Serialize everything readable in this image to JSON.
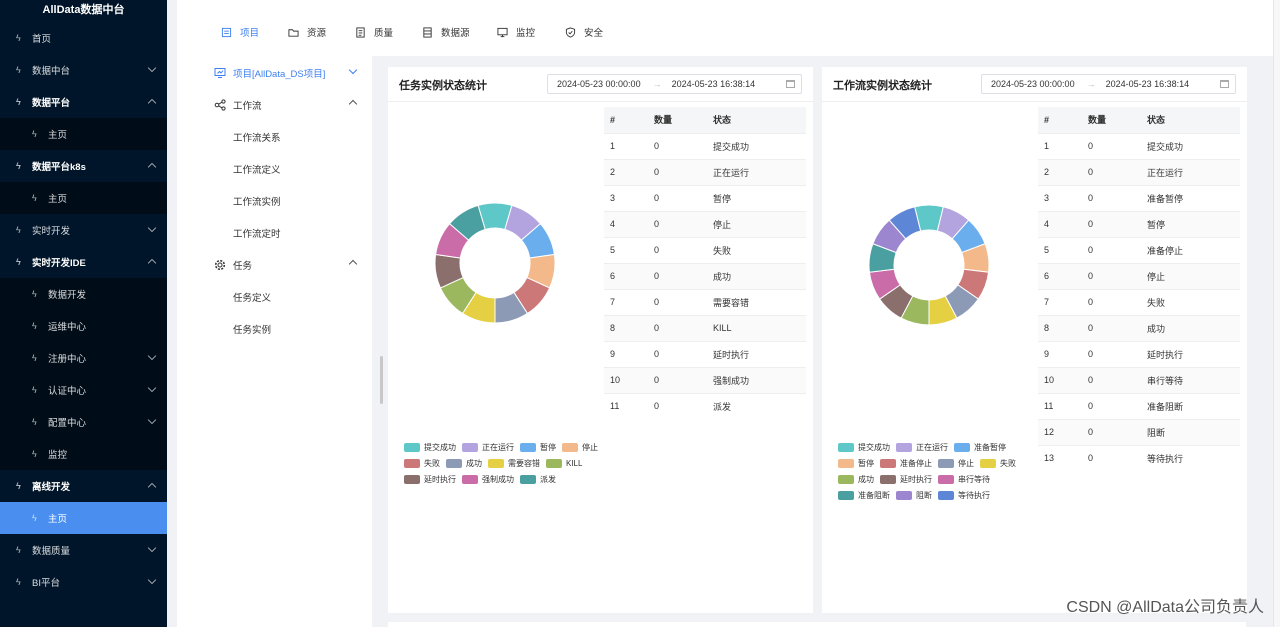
{
  "brand": "AllData数据中台",
  "sidebar": [
    {
      "label": "首页",
      "kind": "top",
      "chev": "none"
    },
    {
      "label": "数据中台",
      "kind": "top",
      "chev": "down"
    },
    {
      "label": "数据平台",
      "kind": "open",
      "chev": "up"
    },
    {
      "label": "主页",
      "kind": "sub",
      "chev": "none"
    },
    {
      "label": "数据平台k8s",
      "kind": "open",
      "chev": "up"
    },
    {
      "label": "主页",
      "kind": "sub",
      "chev": "none"
    },
    {
      "label": "实时开发",
      "kind": "top",
      "chev": "down"
    },
    {
      "label": "实时开发IDE",
      "kind": "open",
      "chev": "up"
    },
    {
      "label": "数据开发",
      "kind": "sub",
      "chev": "none"
    },
    {
      "label": "运维中心",
      "kind": "sub",
      "chev": "none"
    },
    {
      "label": "注册中心",
      "kind": "sub",
      "chev": "down"
    },
    {
      "label": "认证中心",
      "kind": "sub",
      "chev": "down"
    },
    {
      "label": "配置中心",
      "kind": "sub",
      "chev": "down"
    },
    {
      "label": "监控",
      "kind": "sub",
      "chev": "none"
    },
    {
      "label": "离线开发",
      "kind": "open",
      "chev": "up"
    },
    {
      "label": "主页",
      "kind": "active",
      "chev": "none"
    },
    {
      "label": "数据质量",
      "kind": "top",
      "chev": "down"
    },
    {
      "label": "BI平台",
      "kind": "top",
      "chev": "down"
    }
  ],
  "topnav": [
    {
      "label": "项目",
      "icon": "project-icon",
      "active": true
    },
    {
      "label": "资源",
      "icon": "folder-icon",
      "active": false
    },
    {
      "label": "质量",
      "icon": "quality-icon",
      "active": false
    },
    {
      "label": "数据源",
      "icon": "datasource-icon",
      "active": false
    },
    {
      "label": "监控",
      "icon": "monitor-icon",
      "active": false
    },
    {
      "label": "安全",
      "icon": "shield-icon",
      "active": false
    }
  ],
  "submenu": {
    "project": "项目[AllData_DS项目]",
    "workflow": "工作流",
    "workflow_items": [
      "工作流关系",
      "工作流定义",
      "工作流实例",
      "工作流定时"
    ],
    "task": "任务",
    "task_items": [
      "任务定义",
      "任务实例"
    ]
  },
  "task_card": {
    "title": "任务实例状态统计",
    "start": "2024-05-23 00:00:00",
    "end": "2024-05-23 16:38:14",
    "headers": [
      "#",
      "数量",
      "状态"
    ],
    "rows": [
      [
        "1",
        "0",
        "提交成功"
      ],
      [
        "2",
        "0",
        "正在运行"
      ],
      [
        "3",
        "0",
        "暂停"
      ],
      [
        "4",
        "0",
        "停止"
      ],
      [
        "5",
        "0",
        "失败"
      ],
      [
        "6",
        "0",
        "成功"
      ],
      [
        "7",
        "0",
        "需要容错"
      ],
      [
        "8",
        "0",
        "KILL"
      ],
      [
        "9",
        "0",
        "延时执行"
      ],
      [
        "10",
        "0",
        "强制成功"
      ],
      [
        "11",
        "0",
        "派发"
      ]
    ],
    "colors": [
      "#5ec8c8",
      "#b3a3de",
      "#6aaeee",
      "#f4b98a",
      "#cc7878",
      "#8c9ab5",
      "#e4d042",
      "#9bb85e",
      "#8a6f6c",
      "#c96ca7",
      "#4a9fa0"
    ]
  },
  "workflow_card": {
    "title": "工作流实例状态统计",
    "start": "2024-05-23 00:00:00",
    "end": "2024-05-23 16:38:14",
    "headers": [
      "#",
      "数量",
      "状态"
    ],
    "rows": [
      [
        "1",
        "0",
        "提交成功"
      ],
      [
        "2",
        "0",
        "正在运行"
      ],
      [
        "3",
        "0",
        "准备暂停"
      ],
      [
        "4",
        "0",
        "暂停"
      ],
      [
        "5",
        "0",
        "准备停止"
      ],
      [
        "6",
        "0",
        "停止"
      ],
      [
        "7",
        "0",
        "失败"
      ],
      [
        "8",
        "0",
        "成功"
      ],
      [
        "9",
        "0",
        "延时执行"
      ],
      [
        "10",
        "0",
        "串行等待"
      ],
      [
        "11",
        "0",
        "准备阻断"
      ],
      [
        "12",
        "0",
        "阻断"
      ],
      [
        "13",
        "0",
        "等待执行"
      ]
    ],
    "colors": [
      "#5ec8c8",
      "#b3a3de",
      "#6aaeee",
      "#f4b98a",
      "#cc7878",
      "#8c9ab5",
      "#e4d042",
      "#9bb85e",
      "#8a6f6c",
      "#c96ca7",
      "#4a9fa0",
      "#9b86cf",
      "#5d86d6"
    ]
  },
  "chart_data": [
    {
      "type": "pie",
      "title": "任务实例状态统计",
      "categories": [
        "提交成功",
        "正在运行",
        "暂停",
        "停止",
        "失败",
        "成功",
        "需要容错",
        "KILL",
        "延时执行",
        "强制成功",
        "派发"
      ],
      "values": [
        0,
        0,
        0,
        0,
        0,
        0,
        0,
        0,
        0,
        0,
        0
      ]
    },
    {
      "type": "pie",
      "title": "工作流实例状态统计",
      "categories": [
        "提交成功",
        "正在运行",
        "准备暂停",
        "暂停",
        "准备停止",
        "停止",
        "失败",
        "成功",
        "延时执行",
        "串行等待",
        "准备阻断",
        "阻断",
        "等待执行"
      ],
      "values": [
        0,
        0,
        0,
        0,
        0,
        0,
        0,
        0,
        0,
        0,
        0,
        0,
        0
      ]
    }
  ],
  "watermark": "CSDN @AllData公司负责人"
}
